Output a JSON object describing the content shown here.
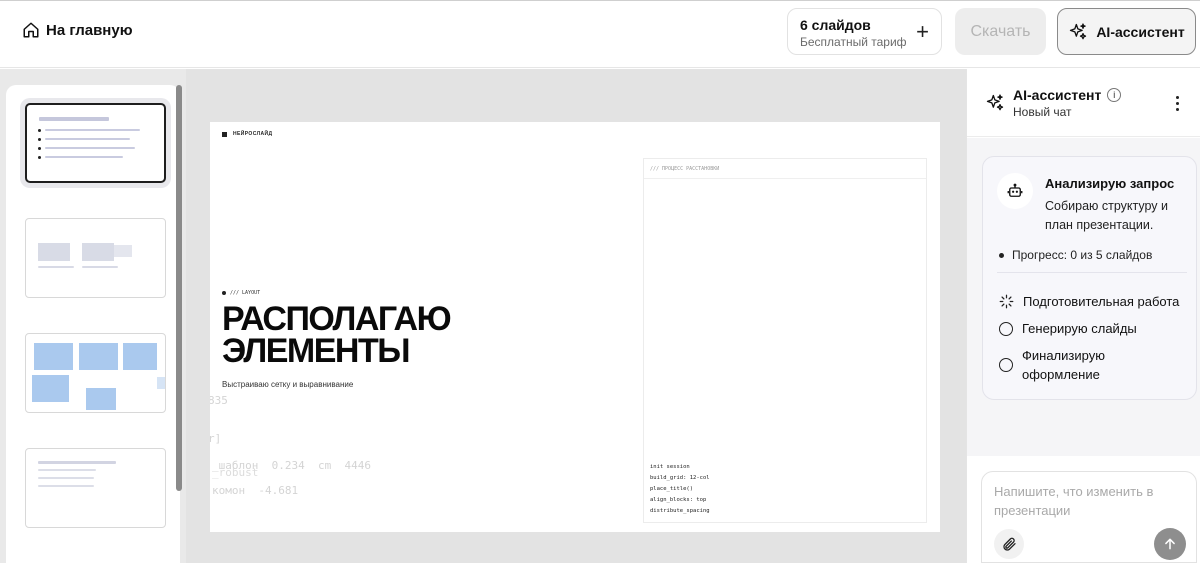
{
  "topbar": {
    "home_label": "На главную",
    "slides_count": "6 слайдов",
    "plan": "Бесплатный тариф",
    "add_symbol": "+",
    "download_label": "Скачать",
    "assistant_label": "AI-ассистент"
  },
  "slide": {
    "brand": "НЕЙРОСЛАЙД",
    "tag": "/// LAYOUT",
    "title_line1": "РАСПОЛАГАЮ",
    "title_line2": "ЭЛЕМЕНТЫ",
    "subtitle": "Выстраиваю сетку и выравнивание",
    "ghost_text": [
      "835",
      "r]",
      "_шаблон  0.234  cm  4446",
      "_robust",
      "комон  -4.681"
    ],
    "process_title": "/// ПРОЦЕСС РАССТАНОВКИ",
    "code_lines": [
      "init session",
      "build_grid: 12-col",
      "place_title()",
      "align_blocks: top",
      "distribute_spacing"
    ]
  },
  "assistant": {
    "title": "AI-ассистент",
    "info_symbol": "i",
    "subtitle": "Новый чат",
    "card": {
      "title": "Анализирую запрос",
      "description": "Собираю структуру и план презентации.",
      "progress": "Прогресс: 0 из 5 слайдов",
      "steps": [
        "Подготовительная работа",
        "Генерирую слайды",
        "Финализирую оформление"
      ]
    },
    "input_placeholder": "Напишите, что изменить в презентации"
  }
}
